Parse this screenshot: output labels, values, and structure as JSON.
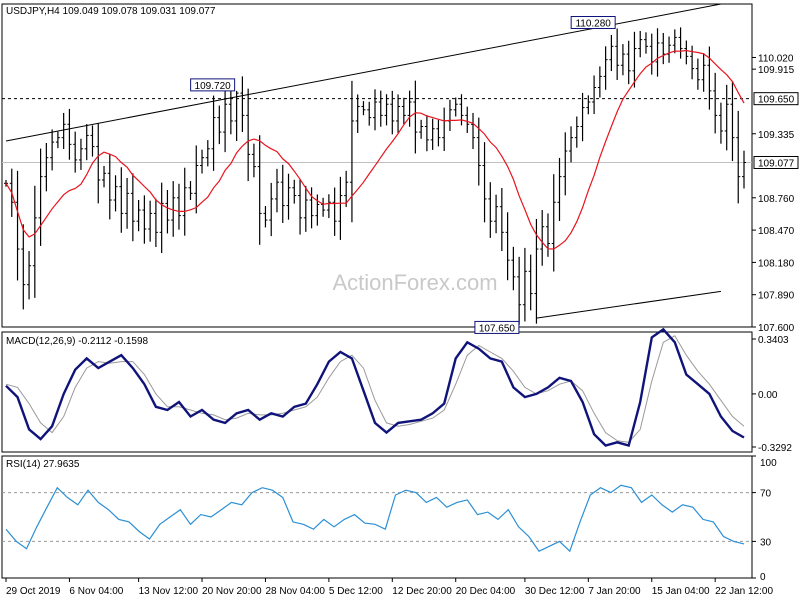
{
  "chart_data": {
    "type": "candlestick",
    "symbol_header": "USDJPY,H4  109.049 109.078 109.031 109.077",
    "watermark": "ActionForex.com",
    "colors": {
      "background": "#ffffff",
      "bars": "#000000",
      "moving_average": "#e8141e",
      "macd_line": "#10147a",
      "macd_signal": "#9a9a9a",
      "rsi_line": "#2b8fd6",
      "dashed_level": "#000000",
      "price_tag_fill": "#ffffff"
    },
    "x_axis": {
      "tick_labels": [
        "29 Oct 2019",
        "6 Nov 04:00",
        "13 Nov 12:00",
        "20 Nov 20:00",
        "28 Nov 04:00",
        "5 Dec 12:00",
        "12 Dec 20:00",
        "20 Dec 04:00",
        "30 Dec 12:00",
        "7 Jan 20:00",
        "15 Jan 04:00",
        "22 Jan 12:00"
      ],
      "tick_index": [
        0,
        11,
        23,
        34,
        45,
        56,
        67,
        78,
        90,
        101,
        112,
        123
      ]
    },
    "price_panel": {
      "ylim": [
        107.6,
        110.5
      ],
      "yticks": [
        110.02,
        109.915,
        109.65,
        109.335,
        109.077,
        108.76,
        108.47,
        108.18,
        107.89,
        107.6
      ],
      "ytick_labels": [
        "110.020",
        "109.915",
        "109.650",
        "109.335",
        "109.077",
        "108.760",
        "108.470",
        "108.180",
        "107.890",
        "107.600"
      ],
      "highlight_levels": [
        109.65,
        109.077
      ],
      "dashed_level": 109.65,
      "current_level": 109.077,
      "close_prices": [
        108.89,
        108.72,
        108.3,
        107.98,
        108.15,
        108.58,
        108.95,
        109.12,
        109.26,
        109.3,
        109.42,
        109.24,
        109.1,
        109.2,
        109.32,
        109.22,
        108.92,
        108.98,
        108.74,
        108.86,
        108.62,
        108.8,
        108.55,
        108.65,
        108.48,
        108.62,
        108.45,
        108.71,
        108.56,
        108.76,
        108.6,
        108.85,
        108.8,
        109.05,
        109.12,
        109.2,
        109.48,
        109.35,
        109.6,
        109.45,
        109.7,
        109.5,
        109.15,
        109.04,
        108.62,
        108.56,
        108.75,
        108.9,
        108.69,
        108.85,
        108.78,
        108.58,
        108.74,
        108.6,
        108.7,
        108.65,
        108.72,
        108.55,
        108.78,
        108.9,
        109.45,
        109.58,
        109.55,
        109.48,
        109.62,
        109.5,
        109.6,
        109.45,
        109.58,
        109.5,
        109.62,
        109.35,
        109.4,
        109.28,
        109.38,
        109.3,
        109.45,
        109.55,
        109.6,
        109.5,
        109.42,
        109.3,
        109.05,
        108.75,
        108.55,
        108.68,
        108.45,
        108.2,
        108.05,
        107.8,
        108.1,
        107.9,
        108.3,
        108.5,
        108.35,
        108.72,
        108.95,
        109.18,
        109.3,
        109.4,
        109.57,
        109.62,
        109.75,
        109.85,
        110.0,
        110.12,
        109.95,
        110.05,
        109.9,
        110.1,
        110.18,
        110.12,
        109.98,
        110.15,
        110.05,
        110.13,
        110.2,
        110.1,
        110.03,
        109.92,
        109.82,
        109.95,
        109.72,
        109.5,
        109.36,
        109.6,
        109.3,
        108.95,
        109.077
      ],
      "annotations": [
        {
          "label": "109.720",
          "bar": 40,
          "value": 109.72
        },
        {
          "label": "110.280",
          "bar": 106,
          "value": 110.28
        },
        {
          "label": "107.650",
          "bar": 90,
          "value": 107.65
        }
      ],
      "channel_upper": [
        [
          0,
          109.27
        ],
        [
          124,
          110.5
        ]
      ],
      "channel_lower": [
        [
          92,
          107.68
        ],
        [
          124,
          107.92
        ]
      ]
    },
    "macd_panel": {
      "title": "MACD(12,26,9) -0.2112 -0.1598",
      "ylim": [
        -0.3292,
        0.3403
      ],
      "yticks": [
        0.3403,
        0.0,
        -0.3292
      ],
      "ytick_labels": [
        "0.3403",
        "0.00",
        "-0.3292"
      ],
      "macd": [
        0.05,
        -0.02,
        -0.22,
        -0.28,
        -0.2,
        0.0,
        0.15,
        0.22,
        0.16,
        0.2,
        0.24,
        0.16,
        0.06,
        -0.08,
        -0.1,
        -0.05,
        -0.14,
        -0.1,
        -0.16,
        -0.18,
        -0.12,
        -0.1,
        -0.16,
        -0.12,
        -0.14,
        -0.08,
        -0.06,
        0.06,
        0.2,
        0.26,
        0.22,
        0.02,
        -0.18,
        -0.24,
        -0.18,
        -0.17,
        -0.16,
        -0.12,
        -0.06,
        0.22,
        0.32,
        0.28,
        0.22,
        0.2,
        0.04,
        -0.02,
        0.0,
        0.04,
        0.1,
        0.08,
        -0.05,
        -0.25,
        -0.32,
        -0.3,
        -0.32,
        -0.05,
        0.35,
        0.4,
        0.32,
        0.12,
        0.06,
        0.0,
        -0.14,
        -0.23,
        -0.27
      ],
      "signal": [
        0.06,
        0.04,
        -0.06,
        -0.18,
        -0.24,
        -0.14,
        0.04,
        0.16,
        0.2,
        0.19,
        0.2,
        0.2,
        0.12,
        0.0,
        -0.08,
        -0.08,
        -0.1,
        -0.12,
        -0.13,
        -0.16,
        -0.15,
        -0.12,
        -0.13,
        -0.13,
        -0.12,
        -0.1,
        -0.08,
        -0.02,
        0.1,
        0.2,
        0.24,
        0.16,
        -0.04,
        -0.18,
        -0.2,
        -0.19,
        -0.17,
        -0.15,
        -0.1,
        0.06,
        0.24,
        0.3,
        0.26,
        0.22,
        0.14,
        0.04,
        0.0,
        0.02,
        0.06,
        0.08,
        0.02,
        -0.12,
        -0.24,
        -0.29,
        -0.3,
        -0.22,
        0.08,
        0.32,
        0.36,
        0.24,
        0.14,
        0.06,
        -0.04,
        -0.14,
        -0.2
      ]
    },
    "rsi_panel": {
      "title": "RSI(14) 27.9635",
      "ylim": [
        0,
        100
      ],
      "yticks": [
        100,
        70,
        30,
        0
      ],
      "ytick_labels": [
        "100",
        "70",
        "30",
        "0"
      ],
      "rsi": [
        40,
        30,
        24,
        42,
        58,
        74,
        66,
        60,
        72,
        62,
        56,
        48,
        46,
        38,
        32,
        44,
        50,
        56,
        44,
        52,
        50,
        56,
        62,
        60,
        70,
        74,
        72,
        66,
        46,
        44,
        40,
        48,
        42,
        48,
        52,
        45,
        44,
        40,
        68,
        72,
        70,
        62,
        66,
        58,
        62,
        64,
        52,
        54,
        48,
        56,
        42,
        34,
        22,
        26,
        30,
        22,
        46,
        68,
        74,
        70,
        76,
        74,
        62,
        68,
        60,
        54,
        60,
        58,
        48,
        46,
        34,
        30,
        27.96
      ]
    }
  }
}
